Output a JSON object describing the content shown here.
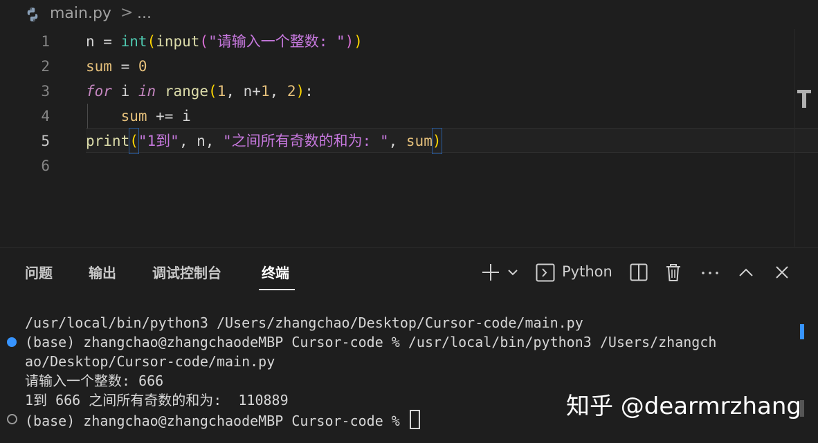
{
  "breadcrumb": {
    "file": "main.py",
    "separator": ">",
    "more": "..."
  },
  "editor": {
    "line_numbers": [
      "1",
      "2",
      "3",
      "4",
      "5",
      "6"
    ],
    "active_line": "5",
    "lines": {
      "l1": {
        "a": "n",
        "b": " = ",
        "c": "int",
        "d": "(",
        "e": "input",
        "f": "(",
        "g": "\"请输入一个整数: \"",
        "h": ")",
        "i": ")"
      },
      "l2": {
        "a": "sum",
        "b": " = ",
        "c": "0"
      },
      "l3": {
        "a": "for",
        "b": " i ",
        "c": "in",
        "d": " ",
        "e": "range",
        "f": "(",
        "g": "1",
        "h": ", n+",
        "i": "1",
        "j": ", ",
        "k": "2",
        "l": ")",
        "m": ":"
      },
      "l4": {
        "a": "    ",
        "b": "sum",
        "c": " += i"
      },
      "l5": {
        "a": "print",
        "b": "(",
        "c": "\"1到\"",
        "d": ", n, ",
        "e": "\"之间所有奇数的和为: \"",
        "f": ", ",
        "g": "sum",
        "h": ")"
      }
    }
  },
  "panel": {
    "tabs": [
      "问题",
      "输出",
      "调试控制台",
      "终端"
    ],
    "active_tab": "终端",
    "terminal_profile": "Python"
  },
  "terminal": {
    "lines": [
      "/usr/local/bin/python3 /Users/zhangchao/Desktop/Cursor-code/main.py",
      "(base) zhangchao@zhangchaodeMBP Cursor-code % /usr/local/bin/python3 /Users/zhangch",
      "ao/Desktop/Cursor-code/main.py",
      "请输入一个整数: 666",
      "1到 666 之间所有奇数的和为:  110889",
      "(base) zhangchao@zhangchaodeMBP Cursor-code % "
    ]
  },
  "watermark": "知乎 @dearmrzhang",
  "colors": {
    "accent": "#3794ff",
    "background": "#1e1e1e"
  }
}
